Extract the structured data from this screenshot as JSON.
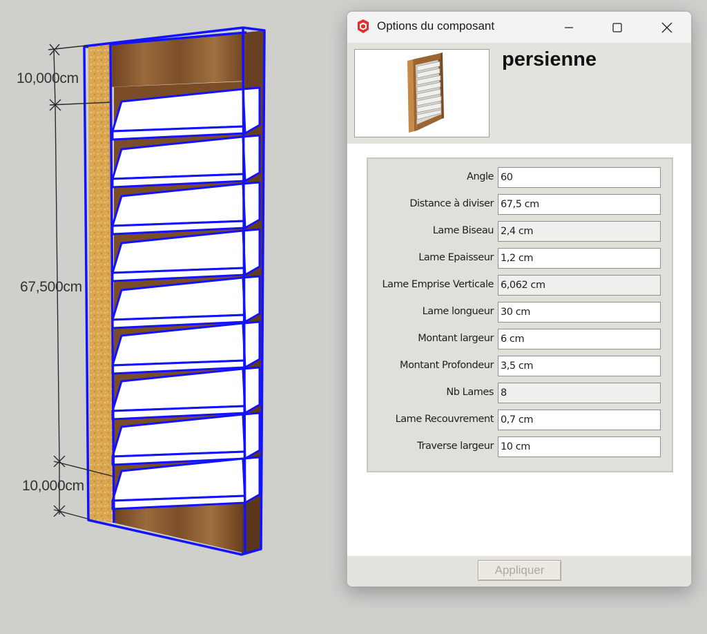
{
  "viewport": {
    "dimensions": [
      "10,000cm",
      "67,500cm",
      "10,000cm"
    ]
  },
  "dialog": {
    "title": "Options du composant",
    "window_controls": {
      "minimize_icon": "minimize-icon",
      "maximize_icon": "maximize-icon",
      "close_icon": "close-icon"
    },
    "component_name": "persienne",
    "parameters": [
      {
        "label": "Angle",
        "value": "60",
        "editable": true
      },
      {
        "label": "Distance à diviser",
        "value": "67,5 cm",
        "editable": true
      },
      {
        "label": "Lame Biseau",
        "value": "2,4 cm",
        "editable": false
      },
      {
        "label": "Lame Epaisseur",
        "value": "1,2 cm",
        "editable": true
      },
      {
        "label": "Lame Emprise Verticale",
        "value": "6,062 cm",
        "editable": false
      },
      {
        "label": "Lame longueur",
        "value": "30 cm",
        "editable": true
      },
      {
        "label": "Montant largeur",
        "value": "6 cm",
        "editable": true
      },
      {
        "label": "Montant Profondeur",
        "value": "3,5 cm",
        "editable": true
      },
      {
        "label": "Nb Lames",
        "value": "8",
        "editable": false
      },
      {
        "label": "Lame Recouvrement",
        "value": "0,7 cm",
        "editable": true
      },
      {
        "label": "Traverse largeur",
        "value": "10 cm",
        "editable": true
      }
    ],
    "apply_label": "Appliquer"
  },
  "colors": {
    "selection": "#1212ff",
    "wood": "#8a5a2e",
    "cork": "#d9a752",
    "panel": "#e4e2dc"
  }
}
